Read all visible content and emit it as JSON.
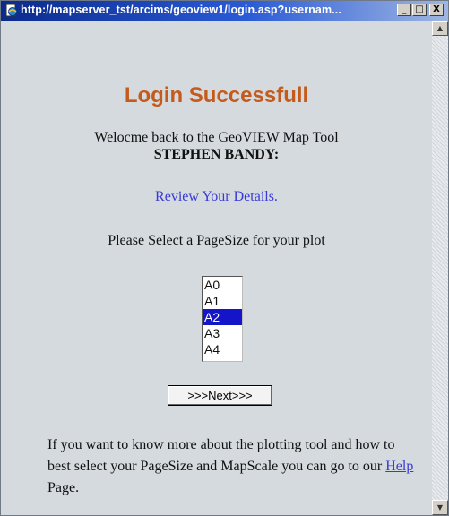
{
  "window": {
    "title": "http://mapserver_tst/arcims/geoview1/login.asp?usernam...",
    "icon": "ie-page-icon",
    "controls": {
      "minimize": "_",
      "maximize": "□",
      "close": "X"
    }
  },
  "page": {
    "heading": "Login Successfull",
    "welcome_text": "Welocme back to the GeoVIEW Map Tool",
    "username": "STEPHEN BANDY:",
    "review_link": "Review Your Details.",
    "pagesize_prompt": "Please Select a PageSize for your plot",
    "pagesize_options": [
      "A0",
      "A1",
      "A2",
      "A3",
      "A4"
    ],
    "pagesize_selected": "A2",
    "next_button": ">>>Next>>>",
    "info_text_before": "If you want to know more about the plotting tool and how to best select your PageSize and MapScale you can go to our ",
    "help_link": "Help",
    "info_text_after": " Page."
  },
  "colors": {
    "heading": "#c45a1c",
    "link": "#3a3ad6",
    "selection": "#1414c8",
    "background": "#d4dadd"
  }
}
